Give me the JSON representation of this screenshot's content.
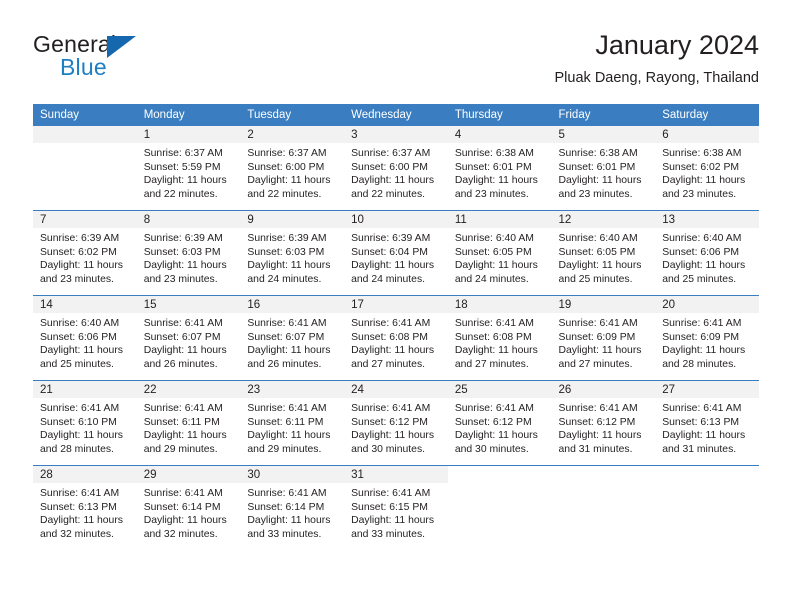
{
  "logo": {
    "word1": "General",
    "word2": "Blue",
    "triangle_color": "#1668ae",
    "blue_color": "#1f7fc4"
  },
  "header": {
    "title": "January 2024",
    "subtitle": "Pluak Daeng, Rayong, Thailand"
  },
  "theme": {
    "header_blue": "#3a7dc0",
    "daynum_gray": "#f2f2f2",
    "text": "#231f20"
  },
  "calendar": {
    "weekday_headers": [
      "Sunday",
      "Monday",
      "Tuesday",
      "Wednesday",
      "Thursday",
      "Friday",
      "Saturday"
    ],
    "weeks": [
      [
        {
          "day": "",
          "sunrise": "",
          "sunset": "",
          "daylight1": "",
          "daylight2": "",
          "state": "empty"
        },
        {
          "day": "1",
          "sunrise": "Sunrise: 6:37 AM",
          "sunset": "Sunset: 5:59 PM",
          "daylight1": "Daylight: 11 hours",
          "daylight2": "and 22 minutes.",
          "state": "filled"
        },
        {
          "day": "2",
          "sunrise": "Sunrise: 6:37 AM",
          "sunset": "Sunset: 6:00 PM",
          "daylight1": "Daylight: 11 hours",
          "daylight2": "and 22 minutes.",
          "state": "filled"
        },
        {
          "day": "3",
          "sunrise": "Sunrise: 6:37 AM",
          "sunset": "Sunset: 6:00 PM",
          "daylight1": "Daylight: 11 hours",
          "daylight2": "and 22 minutes.",
          "state": "filled"
        },
        {
          "day": "4",
          "sunrise": "Sunrise: 6:38 AM",
          "sunset": "Sunset: 6:01 PM",
          "daylight1": "Daylight: 11 hours",
          "daylight2": "and 23 minutes.",
          "state": "filled"
        },
        {
          "day": "5",
          "sunrise": "Sunrise: 6:38 AM",
          "sunset": "Sunset: 6:01 PM",
          "daylight1": "Daylight: 11 hours",
          "daylight2": "and 23 minutes.",
          "state": "filled"
        },
        {
          "day": "6",
          "sunrise": "Sunrise: 6:38 AM",
          "sunset": "Sunset: 6:02 PM",
          "daylight1": "Daylight: 11 hours",
          "daylight2": "and 23 minutes.",
          "state": "filled"
        }
      ],
      [
        {
          "day": "7",
          "sunrise": "Sunrise: 6:39 AM",
          "sunset": "Sunset: 6:02 PM",
          "daylight1": "Daylight: 11 hours",
          "daylight2": "and 23 minutes.",
          "state": "filled"
        },
        {
          "day": "8",
          "sunrise": "Sunrise: 6:39 AM",
          "sunset": "Sunset: 6:03 PM",
          "daylight1": "Daylight: 11 hours",
          "daylight2": "and 23 minutes.",
          "state": "filled"
        },
        {
          "day": "9",
          "sunrise": "Sunrise: 6:39 AM",
          "sunset": "Sunset: 6:03 PM",
          "daylight1": "Daylight: 11 hours",
          "daylight2": "and 24 minutes.",
          "state": "filled"
        },
        {
          "day": "10",
          "sunrise": "Sunrise: 6:39 AM",
          "sunset": "Sunset: 6:04 PM",
          "daylight1": "Daylight: 11 hours",
          "daylight2": "and 24 minutes.",
          "state": "filled"
        },
        {
          "day": "11",
          "sunrise": "Sunrise: 6:40 AM",
          "sunset": "Sunset: 6:05 PM",
          "daylight1": "Daylight: 11 hours",
          "daylight2": "and 24 minutes.",
          "state": "filled"
        },
        {
          "day": "12",
          "sunrise": "Sunrise: 6:40 AM",
          "sunset": "Sunset: 6:05 PM",
          "daylight1": "Daylight: 11 hours",
          "daylight2": "and 25 minutes.",
          "state": "filled"
        },
        {
          "day": "13",
          "sunrise": "Sunrise: 6:40 AM",
          "sunset": "Sunset: 6:06 PM",
          "daylight1": "Daylight: 11 hours",
          "daylight2": "and 25 minutes.",
          "state": "filled"
        }
      ],
      [
        {
          "day": "14",
          "sunrise": "Sunrise: 6:40 AM",
          "sunset": "Sunset: 6:06 PM",
          "daylight1": "Daylight: 11 hours",
          "daylight2": "and 25 minutes.",
          "state": "filled"
        },
        {
          "day": "15",
          "sunrise": "Sunrise: 6:41 AM",
          "sunset": "Sunset: 6:07 PM",
          "daylight1": "Daylight: 11 hours",
          "daylight2": "and 26 minutes.",
          "state": "filled"
        },
        {
          "day": "16",
          "sunrise": "Sunrise: 6:41 AM",
          "sunset": "Sunset: 6:07 PM",
          "daylight1": "Daylight: 11 hours",
          "daylight2": "and 26 minutes.",
          "state": "filled"
        },
        {
          "day": "17",
          "sunrise": "Sunrise: 6:41 AM",
          "sunset": "Sunset: 6:08 PM",
          "daylight1": "Daylight: 11 hours",
          "daylight2": "and 27 minutes.",
          "state": "filled"
        },
        {
          "day": "18",
          "sunrise": "Sunrise: 6:41 AM",
          "sunset": "Sunset: 6:08 PM",
          "daylight1": "Daylight: 11 hours",
          "daylight2": "and 27 minutes.",
          "state": "filled"
        },
        {
          "day": "19",
          "sunrise": "Sunrise: 6:41 AM",
          "sunset": "Sunset: 6:09 PM",
          "daylight1": "Daylight: 11 hours",
          "daylight2": "and 27 minutes.",
          "state": "filled"
        },
        {
          "day": "20",
          "sunrise": "Sunrise: 6:41 AM",
          "sunset": "Sunset: 6:09 PM",
          "daylight1": "Daylight: 11 hours",
          "daylight2": "and 28 minutes.",
          "state": "filled"
        }
      ],
      [
        {
          "day": "21",
          "sunrise": "Sunrise: 6:41 AM",
          "sunset": "Sunset: 6:10 PM",
          "daylight1": "Daylight: 11 hours",
          "daylight2": "and 28 minutes.",
          "state": "filled"
        },
        {
          "day": "22",
          "sunrise": "Sunrise: 6:41 AM",
          "sunset": "Sunset: 6:11 PM",
          "daylight1": "Daylight: 11 hours",
          "daylight2": "and 29 minutes.",
          "state": "filled"
        },
        {
          "day": "23",
          "sunrise": "Sunrise: 6:41 AM",
          "sunset": "Sunset: 6:11 PM",
          "daylight1": "Daylight: 11 hours",
          "daylight2": "and 29 minutes.",
          "state": "filled"
        },
        {
          "day": "24",
          "sunrise": "Sunrise: 6:41 AM",
          "sunset": "Sunset: 6:12 PM",
          "daylight1": "Daylight: 11 hours",
          "daylight2": "and 30 minutes.",
          "state": "filled"
        },
        {
          "day": "25",
          "sunrise": "Sunrise: 6:41 AM",
          "sunset": "Sunset: 6:12 PM",
          "daylight1": "Daylight: 11 hours",
          "daylight2": "and 30 minutes.",
          "state": "filled"
        },
        {
          "day": "26",
          "sunrise": "Sunrise: 6:41 AM",
          "sunset": "Sunset: 6:12 PM",
          "daylight1": "Daylight: 11 hours",
          "daylight2": "and 31 minutes.",
          "state": "filled"
        },
        {
          "day": "27",
          "sunrise": "Sunrise: 6:41 AM",
          "sunset": "Sunset: 6:13 PM",
          "daylight1": "Daylight: 11 hours",
          "daylight2": "and 31 minutes.",
          "state": "filled"
        }
      ],
      [
        {
          "day": "28",
          "sunrise": "Sunrise: 6:41 AM",
          "sunset": "Sunset: 6:13 PM",
          "daylight1": "Daylight: 11 hours",
          "daylight2": "and 32 minutes.",
          "state": "filled"
        },
        {
          "day": "29",
          "sunrise": "Sunrise: 6:41 AM",
          "sunset": "Sunset: 6:14 PM",
          "daylight1": "Daylight: 11 hours",
          "daylight2": "and 32 minutes.",
          "state": "filled"
        },
        {
          "day": "30",
          "sunrise": "Sunrise: 6:41 AM",
          "sunset": "Sunset: 6:14 PM",
          "daylight1": "Daylight: 11 hours",
          "daylight2": "and 33 minutes.",
          "state": "filled"
        },
        {
          "day": "31",
          "sunrise": "Sunrise: 6:41 AM",
          "sunset": "Sunset: 6:15 PM",
          "daylight1": "Daylight: 11 hours",
          "daylight2": "and 33 minutes.",
          "state": "filled"
        },
        {
          "day": "",
          "sunrise": "",
          "sunset": "",
          "daylight1": "",
          "daylight2": "",
          "state": "blank"
        },
        {
          "day": "",
          "sunrise": "",
          "sunset": "",
          "daylight1": "",
          "daylight2": "",
          "state": "blank"
        },
        {
          "day": "",
          "sunrise": "",
          "sunset": "",
          "daylight1": "",
          "daylight2": "",
          "state": "blank"
        }
      ]
    ]
  }
}
